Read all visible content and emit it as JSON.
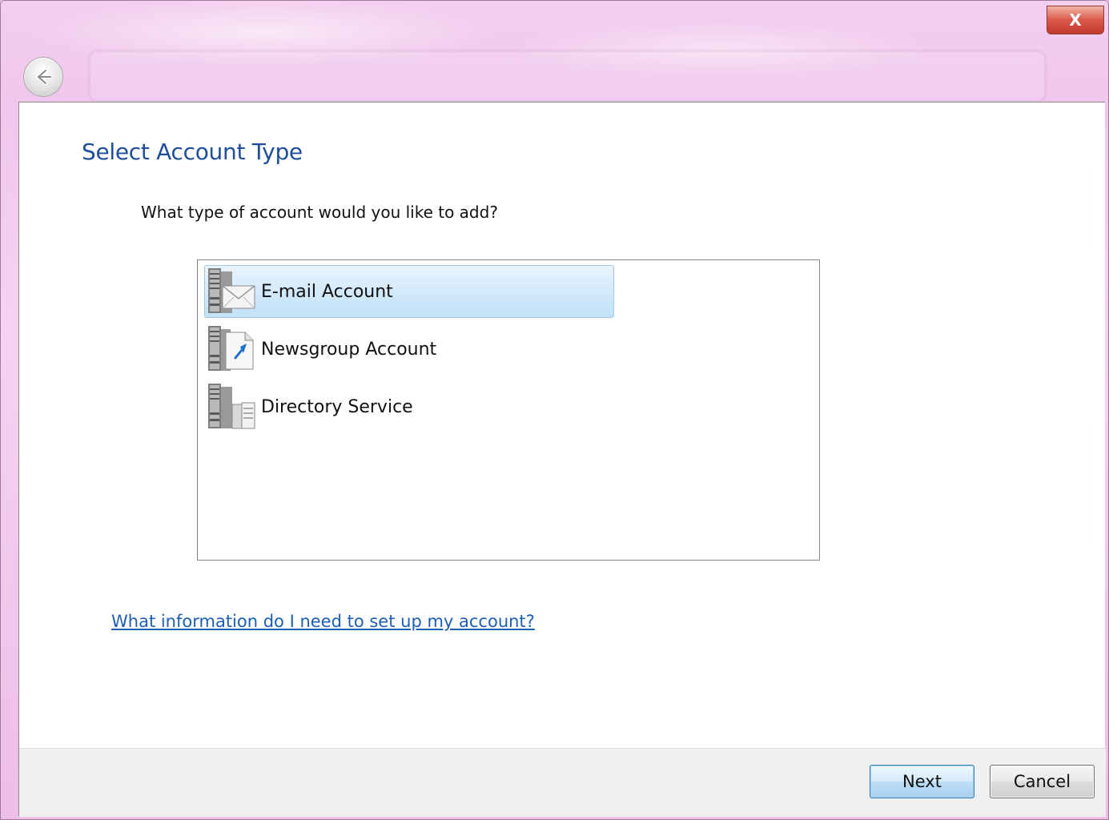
{
  "dialog": {
    "title": "Select Account Type",
    "prompt": "What type of account would you like to add?",
    "help_link": "What information do I need to set up my account?",
    "close_glyph": "X"
  },
  "account_types": [
    {
      "label": "E-mail Account",
      "icon": "email-server-icon",
      "selected": true
    },
    {
      "label": "Newsgroup Account",
      "icon": "newsgroup-server-icon",
      "selected": false
    },
    {
      "label": "Directory Service",
      "icon": "directory-server-icon",
      "selected": false
    }
  ],
  "buttons": {
    "next": "Next",
    "cancel": "Cancel"
  },
  "colors": {
    "title": "#1f4f9c",
    "link": "#1c5fb5",
    "selection": "#c2e1f8",
    "frame": "#efc0ea"
  }
}
